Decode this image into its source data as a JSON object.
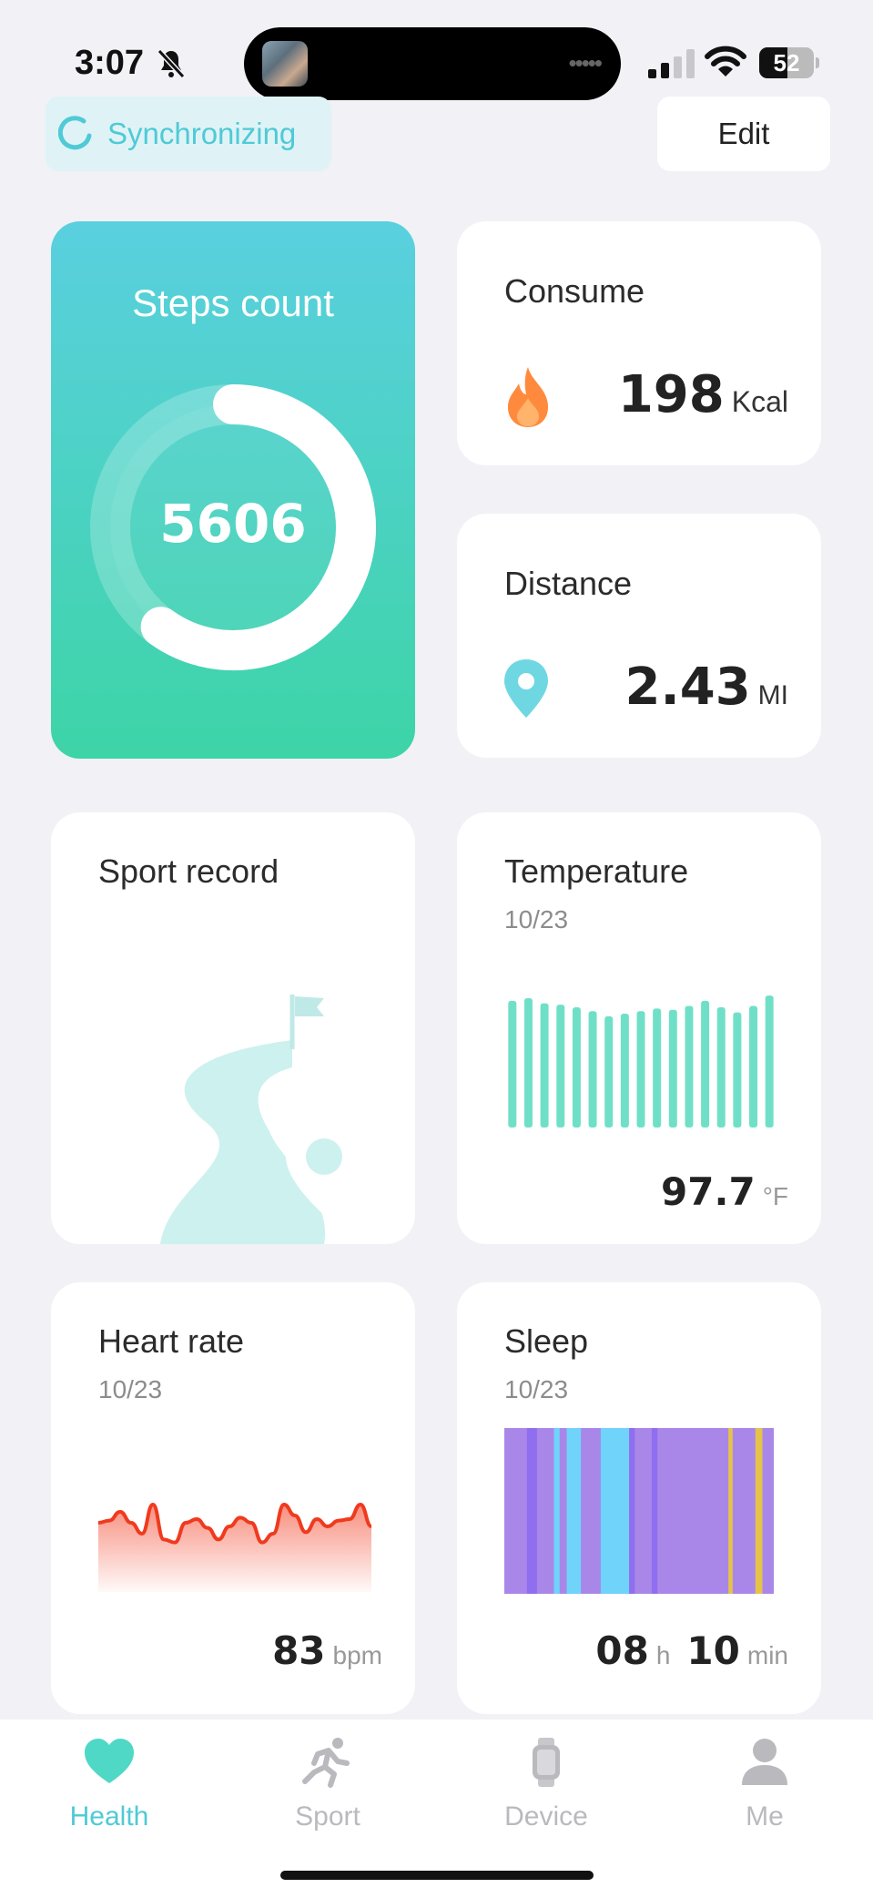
{
  "status_bar": {
    "time": "3:07",
    "battery_level": "52",
    "battery_fraction": 0.52
  },
  "top_bar": {
    "sync_label": "Synchronizing",
    "edit_label": "Edit"
  },
  "steps": {
    "title": "Steps count",
    "value": "5606",
    "progress": 0.6
  },
  "consume": {
    "title": "Consume",
    "value": "198",
    "unit": "Kcal"
  },
  "distance": {
    "title": "Distance",
    "value": "2.43",
    "unit": "MI"
  },
  "sport_record": {
    "title": "Sport record"
  },
  "temperature": {
    "title": "Temperature",
    "date": "10/23",
    "value": "97.7",
    "unit": "°F",
    "bar_levels": [
      0.98,
      1.0,
      0.96,
      0.95,
      0.93,
      0.9,
      0.86,
      0.88,
      0.9,
      0.92,
      0.91,
      0.94,
      0.98,
      0.93,
      0.89,
      0.94,
      1.02
    ]
  },
  "heart_rate": {
    "title": "Heart rate",
    "date": "10/23",
    "value": "83",
    "unit": "bpm",
    "trace": [
      0.55,
      0.52,
      0.4,
      0.55,
      0.7,
      0.3,
      0.78,
      0.82,
      0.55,
      0.5,
      0.62,
      0.78,
      0.6,
      0.48,
      0.55,
      0.82,
      0.7,
      0.3,
      0.45,
      0.68,
      0.5,
      0.6,
      0.52,
      0.5,
      0.3,
      0.6
    ]
  },
  "sleep": {
    "title": "Sleep",
    "date": "10/23",
    "hours": "08",
    "hours_unit": "h",
    "minutes": "10",
    "minutes_unit": "min",
    "stages": [
      "#a987e8",
      "#8f6ef0",
      "#a987e8",
      "#6fd3fa",
      "#a987e8",
      "#6fd3fa",
      "#a987e8",
      "#6fd3fa",
      "#8f6ef0",
      "#a987e8",
      "#8f6ef0",
      "#a987e8",
      "#e5c34a",
      "#a987e8",
      "#e5c34a",
      "#a987e8"
    ],
    "stage_widths": [
      0.08,
      0.035,
      0.06,
      0.02,
      0.025,
      0.05,
      0.07,
      0.1,
      0.02,
      0.06,
      0.02,
      0.25,
      0.015,
      0.08,
      0.025,
      0.04
    ]
  },
  "tabs": [
    {
      "label": "Health",
      "icon": "heart-icon",
      "active": true
    },
    {
      "label": "Sport",
      "icon": "runner-icon",
      "active": false
    },
    {
      "label": "Device",
      "icon": "watch-icon",
      "active": false
    },
    {
      "label": "Me",
      "icon": "person-icon",
      "active": false
    }
  ],
  "colors": {
    "accent": "#4fcad6",
    "teal": "#6fe0c7",
    "flame": "#ff8a3d",
    "heart_line": "#f03a1e"
  }
}
